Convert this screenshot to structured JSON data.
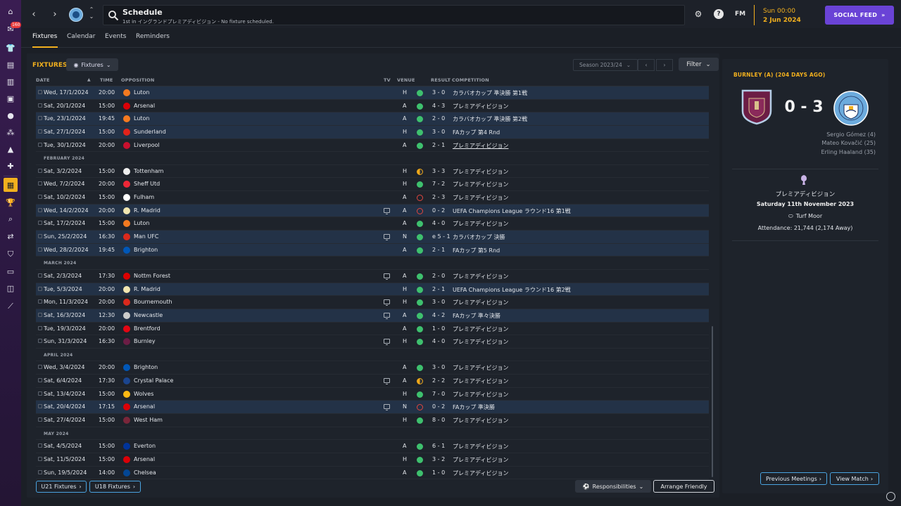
{
  "header": {
    "title": "Schedule",
    "subtitle": "1st in イングランドプレミアディビジョン - No fixture scheduled.",
    "fm_label": "FM",
    "date_line1": "Sun 00:00",
    "date_line2": "2 Jun 2024",
    "social_feed": "SOCIAL FEED",
    "help_label": "?",
    "nav_badge": "160"
  },
  "subtabs": [
    "Fixtures",
    "Calendar",
    "Events",
    "Reminders"
  ],
  "fixtures_panel": {
    "title": "FIXTURES",
    "view_dropdown": "Fixtures",
    "season": "Season 2023/24",
    "filter": "Filter",
    "columns": {
      "date": "DATE",
      "time": "TIME",
      "opposition": "OPPOSITION",
      "tv": "TV",
      "venue": "VENUE",
      "result": "RESULT",
      "competition": "COMPETITION"
    },
    "rows": [
      {
        "type": "match",
        "date": "Wed, 17/1/2024",
        "time": "20:00",
        "opp": "Luton",
        "crest": "#f47a20",
        "tv": false,
        "venue": "H",
        "outcome": "w",
        "result": "3 - 0",
        "comp": "カラバオカップ 準決勝 第1戦",
        "hl": true
      },
      {
        "type": "match",
        "date": "Sat, 20/1/2024",
        "time": "15:00",
        "opp": "Arsenal",
        "crest": "#db0007",
        "tv": false,
        "venue": "A",
        "outcome": "w",
        "result": "4 - 3",
        "comp": "プレミアディビジョン",
        "hl": false
      },
      {
        "type": "match",
        "date": "Tue, 23/1/2024",
        "time": "19:45",
        "opp": "Luton",
        "crest": "#f47a20",
        "tv": false,
        "venue": "A",
        "outcome": "w",
        "result": "2 - 0",
        "comp": "カラバオカップ 準決勝 第2戦",
        "hl": true
      },
      {
        "type": "match",
        "date": "Sat, 27/1/2024",
        "time": "15:00",
        "opp": "Sunderland",
        "crest": "#e2231a",
        "tv": false,
        "venue": "H",
        "outcome": "w",
        "result": "3 - 0",
        "comp": "FAカップ 第4 Rnd",
        "hl": true
      },
      {
        "type": "match",
        "date": "Tue, 30/1/2024",
        "time": "20:00",
        "opp": "Liverpool",
        "crest": "#c8102e",
        "tv": false,
        "venue": "A",
        "outcome": "w",
        "result": "2 - 1",
        "comp": "プレミアディビジョン",
        "hl": false,
        "underline": true
      },
      {
        "type": "month",
        "label": "FEBRUARY 2024"
      },
      {
        "type": "match",
        "date": "Sat, 3/2/2024",
        "time": "15:00",
        "opp": "Tottenham",
        "crest": "#eeeeee",
        "tv": false,
        "venue": "H",
        "outcome": "d",
        "result": "3 - 3",
        "comp": "プレミアディビジョン",
        "hl": false
      },
      {
        "type": "match",
        "date": "Wed, 7/2/2024",
        "time": "20:00",
        "opp": "Sheff Utd",
        "crest": "#ee2737",
        "tv": false,
        "venue": "H",
        "outcome": "w",
        "result": "7 - 2",
        "comp": "プレミアディビジョン",
        "hl": false
      },
      {
        "type": "match",
        "date": "Sat, 10/2/2024",
        "time": "15:00",
        "opp": "Fulham",
        "crest": "#ffffff",
        "tv": false,
        "venue": "A",
        "outcome": "l",
        "result": "2 - 3",
        "comp": "プレミアディビジョン",
        "hl": false
      },
      {
        "type": "match",
        "date": "Wed, 14/2/2024",
        "time": "20:00",
        "opp": "R. Madrid",
        "crest": "#f2e6b0",
        "tv": true,
        "venue": "A",
        "outcome": "l",
        "result": "0 - 2",
        "comp": "UEFA Champions League ラウンド16 第1戦",
        "hl": true
      },
      {
        "type": "match",
        "date": "Sat, 17/2/2024",
        "time": "15:00",
        "opp": "Luton",
        "crest": "#f47a20",
        "tv": false,
        "venue": "A",
        "outcome": "w",
        "result": "4 - 0",
        "comp": "プレミアディビジョン",
        "hl": false
      },
      {
        "type": "match",
        "date": "Sun, 25/2/2024",
        "time": "16:30",
        "opp": "Man UFC",
        "crest": "#da291c",
        "tv": true,
        "venue": "N",
        "outcome": "w",
        "result": "e 5 - 1",
        "comp": "カラバオカップ 決勝",
        "hl": true
      },
      {
        "type": "match",
        "date": "Wed, 28/2/2024",
        "time": "19:45",
        "opp": "Brighton",
        "crest": "#0057b8",
        "tv": false,
        "venue": "A",
        "outcome": "w",
        "result": "2 - 1",
        "comp": "FAカップ 第5 Rnd",
        "hl": true
      },
      {
        "type": "month",
        "label": "MARCH 2024"
      },
      {
        "type": "match",
        "date": "Sat, 2/3/2024",
        "time": "17:30",
        "opp": "Nottm Forest",
        "crest": "#dd0000",
        "tv": true,
        "venue": "A",
        "outcome": "w",
        "result": "2 - 0",
        "comp": "プレミアディビジョン",
        "hl": false
      },
      {
        "type": "match",
        "date": "Tue, 5/3/2024",
        "time": "20:00",
        "opp": "R. Madrid",
        "crest": "#f2e6b0",
        "tv": false,
        "venue": "H",
        "outcome": "w",
        "result": "2 - 1",
        "comp": "UEFA Champions League ラウンド16 第2戦",
        "hl": true
      },
      {
        "type": "match",
        "date": "Mon, 11/3/2024",
        "time": "20:00",
        "opp": "Bournemouth",
        "crest": "#da291c",
        "tv": true,
        "venue": "H",
        "outcome": "w",
        "result": "3 - 0",
        "comp": "プレミアディビジョン",
        "hl": false
      },
      {
        "type": "match",
        "date": "Sat, 16/3/2024",
        "time": "12:30",
        "opp": "Newcastle",
        "crest": "#cccccc",
        "tv": true,
        "venue": "A",
        "outcome": "w",
        "result": "4 - 2",
        "comp": "FAカップ 準々決勝",
        "hl": true
      },
      {
        "type": "match",
        "date": "Tue, 19/3/2024",
        "time": "20:00",
        "opp": "Brentford",
        "crest": "#e30613",
        "tv": false,
        "venue": "A",
        "outcome": "w",
        "result": "1 - 0",
        "comp": "プレミアディビジョン",
        "hl": false
      },
      {
        "type": "match",
        "date": "Sun, 31/3/2024",
        "time": "16:30",
        "opp": "Burnley",
        "crest": "#6c1d45",
        "tv": true,
        "venue": "H",
        "outcome": "w",
        "result": "4 - 0",
        "comp": "プレミアディビジョン",
        "hl": false
      },
      {
        "type": "month",
        "label": "APRIL 2024"
      },
      {
        "type": "match",
        "date": "Wed, 3/4/2024",
        "time": "20:00",
        "opp": "Brighton",
        "crest": "#0057b8",
        "tv": false,
        "venue": "A",
        "outcome": "w",
        "result": "3 - 0",
        "comp": "プレミアディビジョン",
        "hl": false
      },
      {
        "type": "match",
        "date": "Sat, 6/4/2024",
        "time": "17:30",
        "opp": "Crystal Palace",
        "crest": "#1b458f",
        "tv": true,
        "venue": "A",
        "outcome": "d",
        "result": "2 - 2",
        "comp": "プレミアディビジョン",
        "hl": false
      },
      {
        "type": "match",
        "date": "Sat, 13/4/2024",
        "time": "15:00",
        "opp": "Wolves",
        "crest": "#fdb913",
        "tv": false,
        "venue": "H",
        "outcome": "w",
        "result": "7 - 0",
        "comp": "プレミアディビジョン",
        "hl": false
      },
      {
        "type": "match",
        "date": "Sat, 20/4/2024",
        "time": "17:15",
        "opp": "Arsenal",
        "crest": "#db0007",
        "tv": true,
        "venue": "N",
        "outcome": "l",
        "result": "0 - 2",
        "comp": "FAカップ 準決勝",
        "hl": true
      },
      {
        "type": "match",
        "date": "Sat, 27/4/2024",
        "time": "15:00",
        "opp": "West Ham",
        "crest": "#7a263a",
        "tv": false,
        "venue": "H",
        "outcome": "w",
        "result": "8 - 0",
        "comp": "プレミアディビジョン",
        "hl": false
      },
      {
        "type": "month",
        "label": "MAY 2024"
      },
      {
        "type": "match",
        "date": "Sat, 4/5/2024",
        "time": "15:00",
        "opp": "Everton",
        "crest": "#003399",
        "tv": false,
        "venue": "A",
        "outcome": "w",
        "result": "6 - 1",
        "comp": "プレミアディビジョン",
        "hl": false
      },
      {
        "type": "match",
        "date": "Sat, 11/5/2024",
        "time": "15:00",
        "opp": "Arsenal",
        "crest": "#db0007",
        "tv": false,
        "venue": "H",
        "outcome": "w",
        "result": "3 - 2",
        "comp": "プレミアディビジョン",
        "hl": false
      },
      {
        "type": "match",
        "date": "Sun, 19/5/2024",
        "time": "14:00",
        "opp": "Chelsea",
        "crest": "#034694",
        "tv": false,
        "venue": "A",
        "outcome": "w",
        "result": "1 - 0",
        "comp": "プレミアディビジョン",
        "hl": false
      }
    ],
    "u21_button": "U21 Fixtures",
    "u18_button": "U18 Fixtures",
    "responsibilities": "Responsibilities",
    "arrange_friendly": "Arrange Friendly"
  },
  "match_panel": {
    "title": "BURNLEY (A) (204 DAYS AGO)",
    "score": "0 - 3",
    "scorers": [
      "Sergio Gómez (4)",
      "Mateo Kovačić (25)",
      "Erling Haaland (35)"
    ],
    "competition": "プレミアディビジョン",
    "date": "Saturday 11th November 2023",
    "venue": "Turf Moor",
    "attendance": "Attendance: 21,744 (2,174 Away)",
    "previous_meetings": "Previous Meetings",
    "view_match": "View Match"
  },
  "colors": {
    "accent": "#f2b01e",
    "win": "#3ec06e",
    "loss": "#e2463f",
    "draw": "#f0a81a",
    "highlight_row": "#233247",
    "social_feed": "#6a43d6"
  }
}
